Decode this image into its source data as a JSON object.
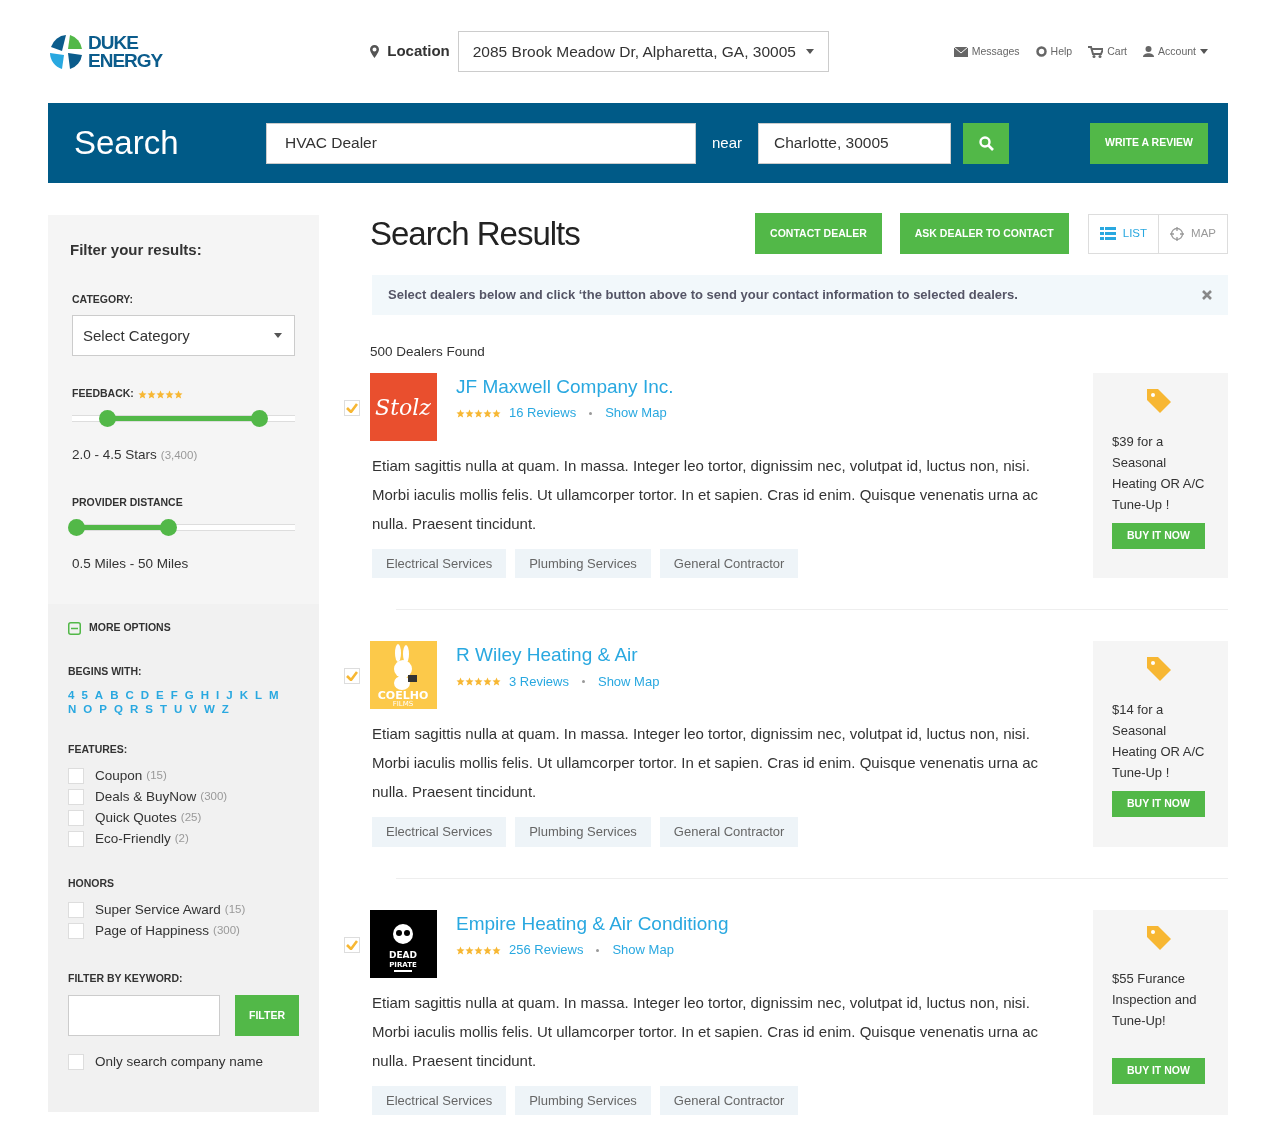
{
  "header": {
    "logo": [
      "DUKE",
      "ENERGY"
    ],
    "location_label": "Location",
    "location_value": "2085 Brook Meadow Dr, Alpharetta, GA, 30005",
    "nav": [
      {
        "kind": "messages",
        "label": "Messages"
      },
      {
        "kind": "help",
        "label": "Help"
      },
      {
        "kind": "cart",
        "label": "Cart"
      },
      {
        "kind": "account",
        "label": "Account"
      }
    ]
  },
  "search_bar": {
    "title": "Search",
    "query": "HVAC Dealer",
    "near_label": "near",
    "near_value": "Charlotte, 30005",
    "write_review": "WRITE A REVIEW"
  },
  "sidebar": {
    "title": "Filter your results:",
    "category_label": "CATEGORY:",
    "category_value": "Select Category",
    "feedback": {
      "label": "FEEDBACK:",
      "stars": 5,
      "handles": [
        {
          "level": 0.155
        },
        {
          "level": 0.84
        }
      ],
      "reading": "2.0 - 4.5 Stars",
      "count": "(3,400)"
    },
    "distance": {
      "label": "PROVIDER DISTANCE",
      "handles": [
        {
          "level": 0.02
        },
        {
          "level": 0.43
        }
      ],
      "reading": "0.5 Miles - 50 Miles"
    },
    "more_options": {
      "label": "MORE OPTIONS",
      "expanded": true
    },
    "begins_with": {
      "label": "BEGINS WITH:",
      "letters": [
        "4",
        "5",
        "A",
        "B",
        "C",
        "D",
        "E",
        "F",
        "G",
        "H",
        "I",
        "J",
        "K",
        "L",
        "M",
        "N",
        "O",
        "P",
        "Q",
        "R",
        "S",
        "T",
        "U",
        "V",
        "W",
        "Z"
      ]
    },
    "features": {
      "label": "FEATURES:",
      "items": [
        {
          "label": "Coupon",
          "count": "(15)",
          "checked": false
        },
        {
          "label": "Deals & BuyNow",
          "count": "(300)",
          "checked": false
        },
        {
          "label": "Quick Quotes",
          "count": "(25)",
          "checked": false
        },
        {
          "label": "Eco-Friendly",
          "count": "(2)",
          "checked": false
        }
      ]
    },
    "honors": {
      "label": "HONORS",
      "items": [
        {
          "label": "Super Service Award",
          "count": "(15)",
          "checked": false
        },
        {
          "label": "Page of Happiness",
          "count": "(300)",
          "checked": false
        }
      ]
    },
    "keyword": {
      "label": "FILTER BY KEYWORD:",
      "button": "FILTER",
      "only_company": {
        "label": "Only search company name",
        "checked": false
      }
    }
  },
  "results": {
    "title": "Search Results",
    "buttons": [
      "CONTACT DEALER",
      "ASK DEALER TO CONTACT"
    ],
    "views": [
      {
        "kind": "list",
        "label": "LIST",
        "selected": true
      },
      {
        "kind": "map",
        "label": "MAP",
        "selected": false
      }
    ],
    "alert": "Select dealers below and click ‘the button above to send your contact information to selected dealers.",
    "count": "500 Dealers Found",
    "dealers": [
      {
        "checked": true,
        "logo": {
          "kind": "script",
          "texts": [
            "Stolz"
          ],
          "color": "#e94f2e"
        },
        "name": "JF Maxwell Company Inc.",
        "stars": 5,
        "reviews": "16 Reviews",
        "show_map": "Show Map",
        "description": "Etiam sagittis nulla at quam. In massa. Integer leo tortor, dignissim nec, volutpat id, luctus non, nisi. Morbi iaculis mollis felis. Ut ullamcorper tortor. In et sapien. Cras id enim. Quisque venenatis urna ac nulla. Praesent tincidunt.",
        "tags": [
          "Electrical Services",
          "Plumbing Services",
          "General Contractor"
        ],
        "promo": "$39 for a Seasonal Heating OR A/C Tune-Up !",
        "buy": "BUY IT NOW"
      },
      {
        "checked": true,
        "logo": {
          "kind": "rabbit",
          "texts": [
            "COELHO",
            "FILMS"
          ],
          "color": "#fcc94a"
        },
        "name": "R Wiley Heating & Air",
        "stars": 5,
        "reviews": "3 Reviews",
        "show_map": "Show Map",
        "description": "Etiam sagittis nulla at quam. In massa. Integer leo tortor, dignissim nec, volutpat id, luctus non, nisi. Morbi iaculis mollis felis. Ut ullamcorper tortor. In et sapien. Cras id enim. Quisque venenatis urna ac nulla. Praesent tincidunt.",
        "tags": [
          "Electrical Services",
          "Plumbing Services",
          "General Contractor"
        ],
        "promo": "$14 for a Seasonal Heating OR A/C Tune-Up !",
        "buy": "BUY IT NOW"
      },
      {
        "checked": true,
        "logo": {
          "kind": "skull",
          "texts": [
            "DEAD",
            "PIRATE"
          ],
          "color": "#000000"
        },
        "name": "Empire Heating & Air Conditiong",
        "stars": 5,
        "reviews": "256 Reviews",
        "show_map": "Show Map",
        "description": "Etiam sagittis nulla at quam. In massa. Integer leo tortor, dignissim nec, volutpat id, luctus non, nisi. Morbi iaculis mollis felis. Ut ullamcorper tortor. In et sapien. Cras id enim. Quisque venenatis urna ac nulla. Praesent tincidunt.",
        "tags": [
          "Electrical Services",
          "Plumbing Services",
          "General Contractor"
        ],
        "promo": "$55 Furance Inspection and Tune-Up!",
        "buy": "BUY IT NOW"
      }
    ]
  }
}
